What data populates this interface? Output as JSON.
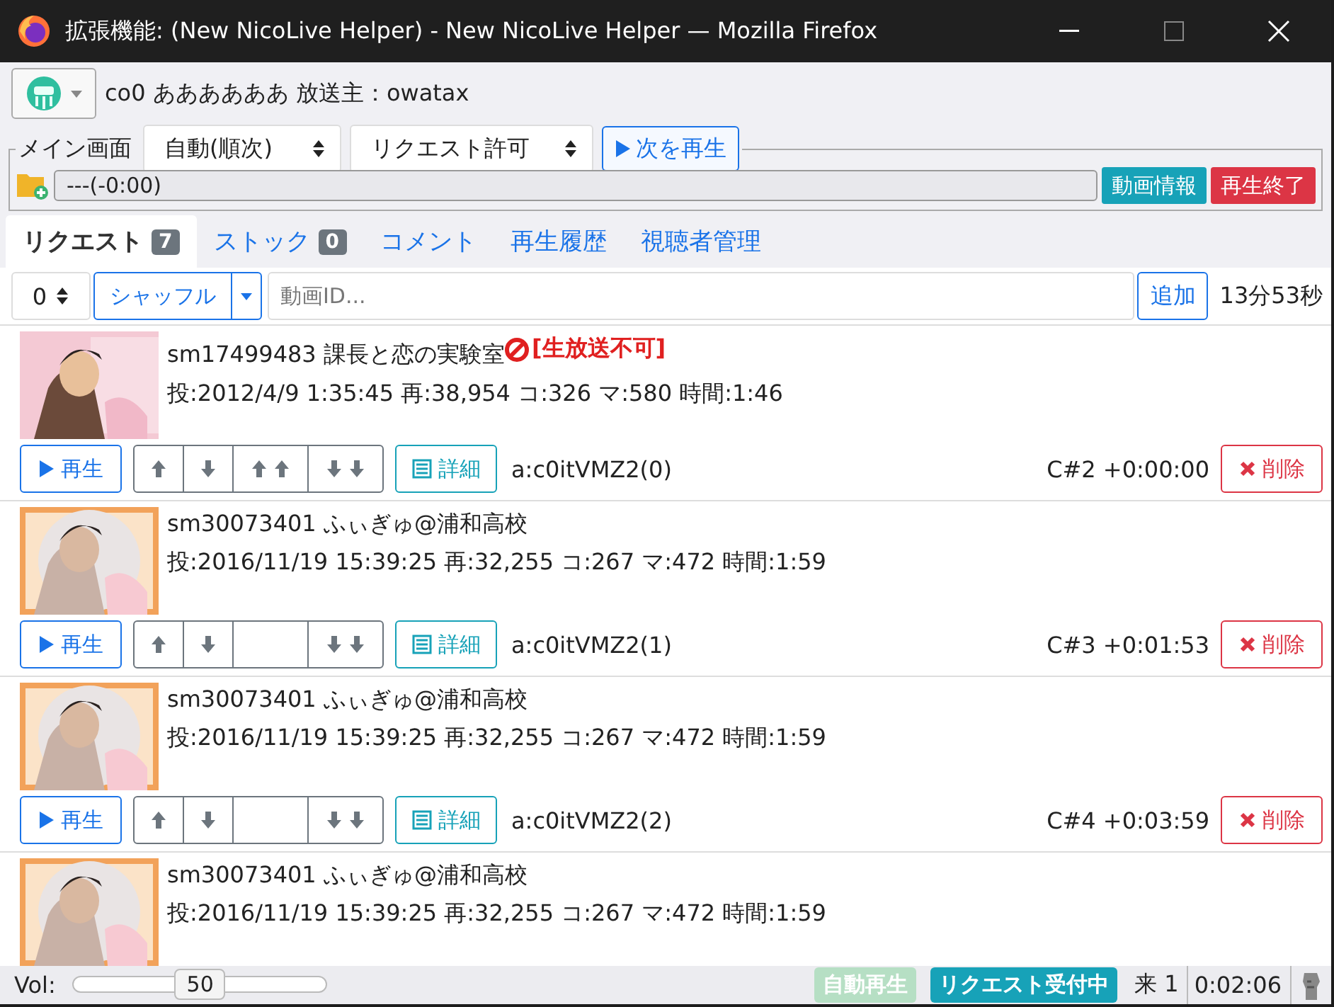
{
  "window": {
    "title": "拡張機能: (New NicoLive Helper) - New NicoLive Helper — Mozilla Firefox"
  },
  "header": {
    "broadcast": "co0 ああああああ 放送主：owatax"
  },
  "main_panel": {
    "legend": "メイン画面",
    "selects": [
      "自動(順次)",
      "リクエスト許可"
    ],
    "play_next": "次を再生",
    "now_playing": "---(-0:00)",
    "info_button": "動画情報",
    "stop_button": "再生終了"
  },
  "tabs": [
    {
      "label": "リクエスト",
      "count": "7",
      "selected": true
    },
    {
      "label": "ストック",
      "count": "0",
      "selected": false
    },
    {
      "label": "コメント",
      "selected": false
    },
    {
      "label": "再生履歴",
      "selected": false
    },
    {
      "label": "視聴者管理",
      "selected": false
    }
  ],
  "toolbar": {
    "number": "0",
    "shuffle": "シャッフル",
    "placeholder": "動画ID...",
    "add": "追加",
    "total": "13分53秒"
  },
  "requests": [
    {
      "title": "sm17499483 課長と恋の実験室",
      "warning": "[生放送不可]",
      "meta": "投:2012/4/9 1:35:45 再:38,954 コ:326 マ:580 時間:1:46",
      "play": "再生",
      "detail": "詳細",
      "requester": "a:c0itVMZ2(0)",
      "position": "C#2 +0:00:00",
      "delete": "削除"
    },
    {
      "title": "sm30073401 ふぃぎゅ@浦和高校",
      "meta": "投:2016/11/19 15:39:25 再:32,255 コ:267 マ:472 時間:1:59",
      "play": "再生",
      "detail": "詳細",
      "requester": "a:c0itVMZ2(1)",
      "position": "C#3 +0:01:53",
      "delete": "削除"
    },
    {
      "title": "sm30073401 ふぃぎゅ@浦和高校",
      "meta": "投:2016/11/19 15:39:25 再:32,255 コ:267 マ:472 時間:1:59",
      "play": "再生",
      "detail": "詳細",
      "requester": "a:c0itVMZ2(2)",
      "position": "C#4 +0:03:59",
      "delete": "削除"
    },
    {
      "title": "sm30073401 ふぃぎゅ@浦和高校",
      "meta": "投:2016/11/19 15:39:25 再:32,255 コ:267 マ:472 時間:1:59"
    }
  ],
  "status_bar": {
    "volume_label": "Vol:",
    "volume": {
      "level": 0.5,
      "reading": "50"
    },
    "badges": [
      {
        "label": "自動再生",
        "on": false
      },
      {
        "label": "リクエスト受付中",
        "on": true
      }
    ],
    "visitors": "来 1",
    "elapsed": "0:02:06"
  }
}
